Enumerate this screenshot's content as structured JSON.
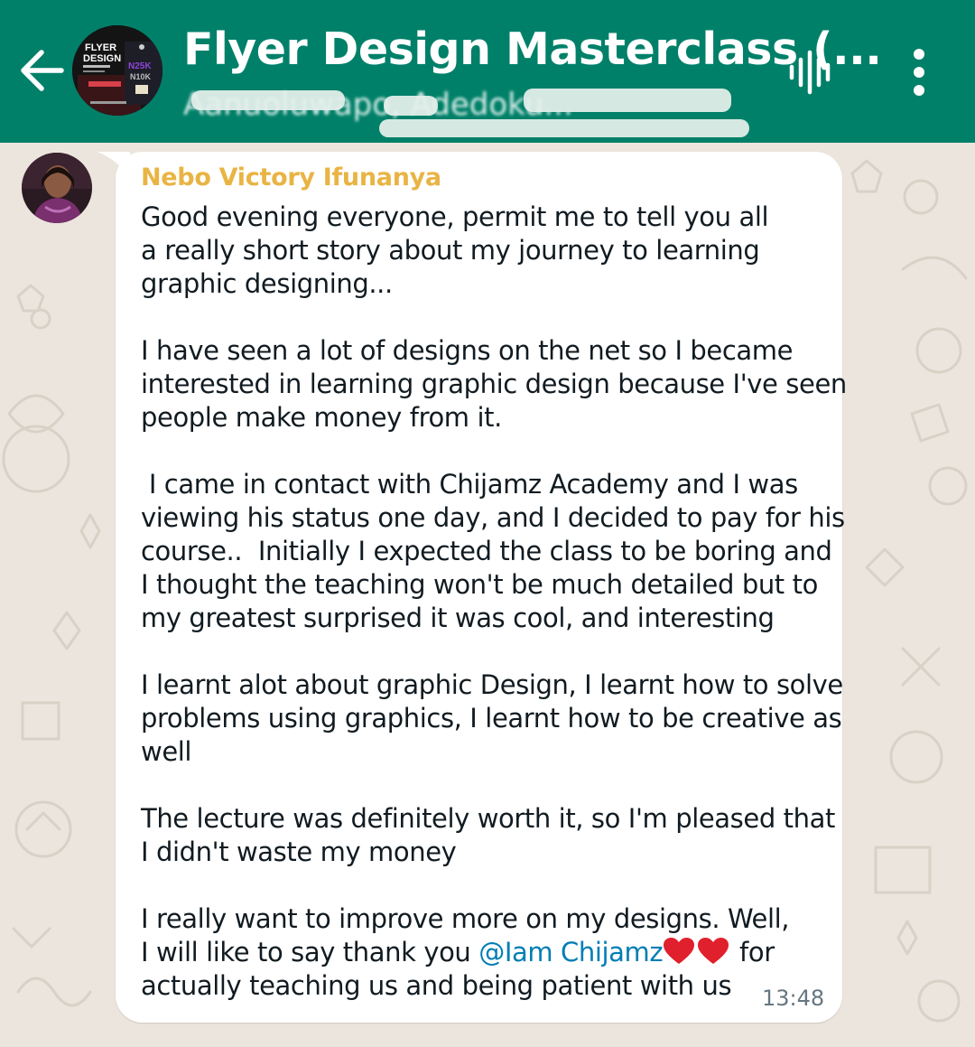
{
  "header": {
    "title": "Flyer Design Masterclass (...",
    "subtitle": "Aanuoluwapo, Adedoku...",
    "avatar_text": {
      "line1": "FLYER",
      "line2": "DESIGN",
      "price_new": "N25K",
      "price_old": "N10K"
    },
    "icons": [
      "arrow-back-icon",
      "voice-call-icon",
      "more-vertical-icon"
    ]
  },
  "message": {
    "sender": "Nebo Victory Ifunanya",
    "lines": [
      "Good evening everyone, permit me to tell you all",
      "a really short story about my journey to learning",
      "graphic designing...",
      "",
      "I have seen a lot of designs on the net so I became",
      "interested in learning graphic design because I've seen",
      "people make money from it.",
      "",
      " I came in contact with Chijamz Academy and I was",
      "viewing his status one day, and I decided to pay for his",
      "course..  Initially I expected the class to be boring and",
      "I thought the teaching won't be much detailed but to",
      "my greatest surprised it was cool, and interesting",
      "",
      "I learnt alot about graphic Design, I learnt how to solve",
      "problems using graphics, I learnt how to be creative as",
      "well",
      "",
      "The lecture was definitely worth it, so I'm pleased that",
      "I didn't waste my money",
      "",
      "I really want to improve more on my designs. Well,"
    ],
    "line_mention_before": "I will like to say thank you ",
    "mention": "@Iam Chijamz",
    "line_mention_after": " for",
    "last_line": "actually teaching us and being patient with us",
    "time": "13:48"
  },
  "colors": {
    "header_bg": "#008069",
    "chat_bg": "#ece5dd",
    "sender_name": "#e9b444",
    "mention": "#027eb5",
    "heart": "#e0202c",
    "timestamp": "#667781"
  }
}
